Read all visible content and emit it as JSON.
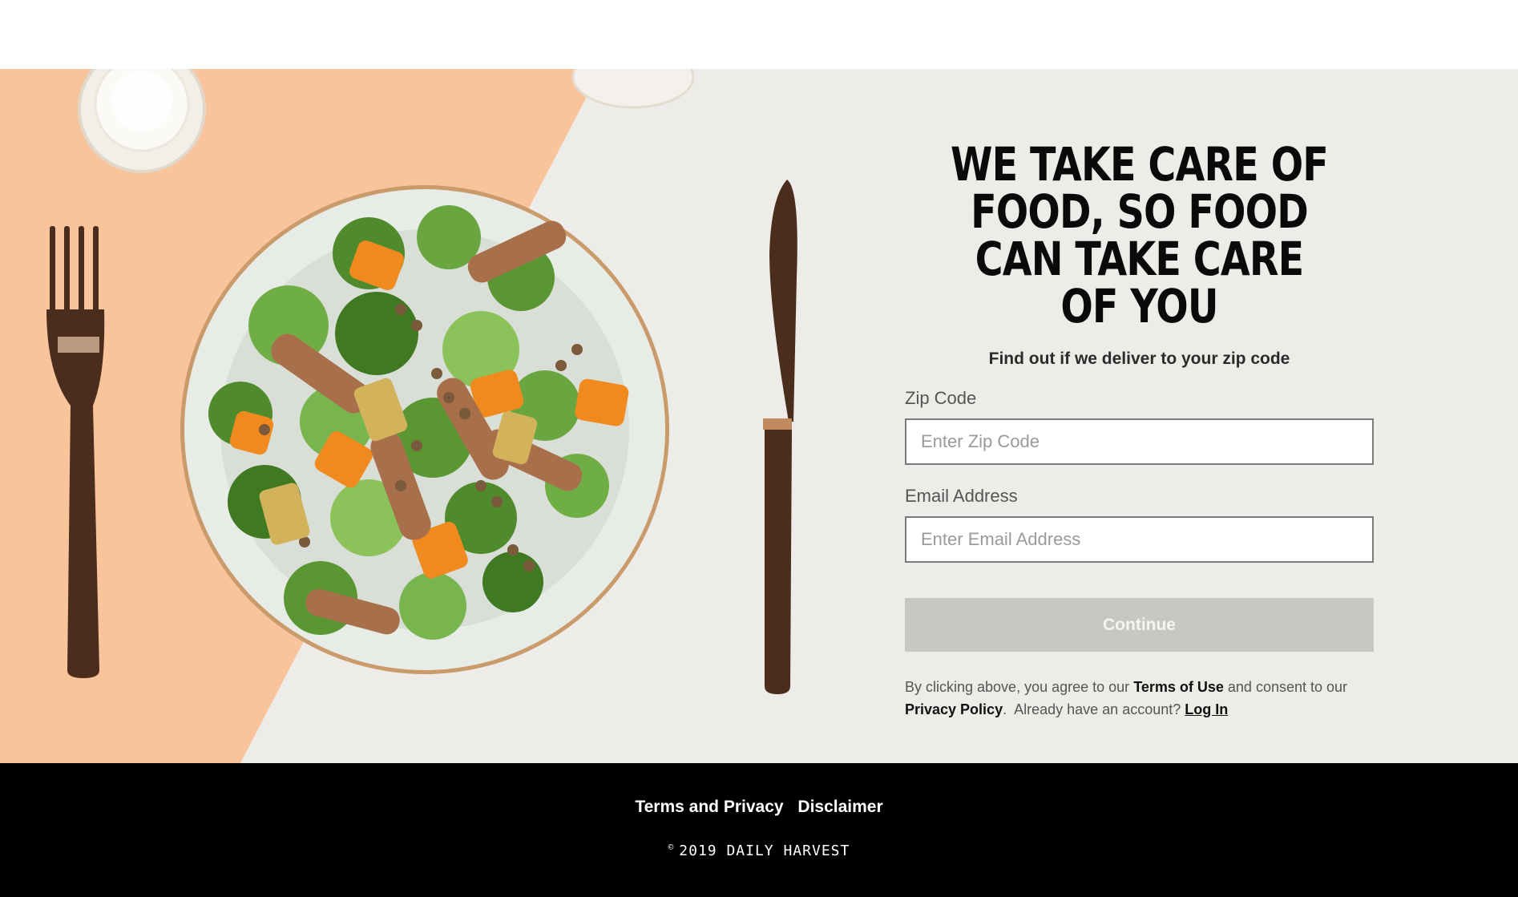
{
  "hero": {
    "headline": "WE TAKE CARE OF FOOD, SO FOOD CAN TAKE CARE OF YOU",
    "subheadline": "Find out if we deliver to your zip code",
    "image_icons": [
      "fork-icon",
      "knife-icon",
      "salad-plate-icon",
      "glass-icon"
    ],
    "colors": {
      "peach": "#f9c49c",
      "table": "#edece8"
    }
  },
  "form": {
    "zip_label": "Zip Code",
    "zip_placeholder": "Enter Zip Code",
    "zip_value": "",
    "email_label": "Email Address",
    "email_placeholder": "Enter Email Address",
    "email_value": "",
    "continue_label": "Continue",
    "continue_color": "#c8c7c3"
  },
  "legal": {
    "prefix": "By clicking above, you agree to our",
    "terms_link": "Terms of Use",
    "middle": "and consent to our",
    "privacy_link": "Privacy Policy",
    "account_text": "Already have an account?",
    "login_link": "Log In"
  },
  "footer": {
    "terms_link": "Terms and Privacy",
    "disclaimer_link": "Disclaimer",
    "copyright_symbol": "©",
    "copyright_text": "2019 DAILY HARVEST"
  }
}
